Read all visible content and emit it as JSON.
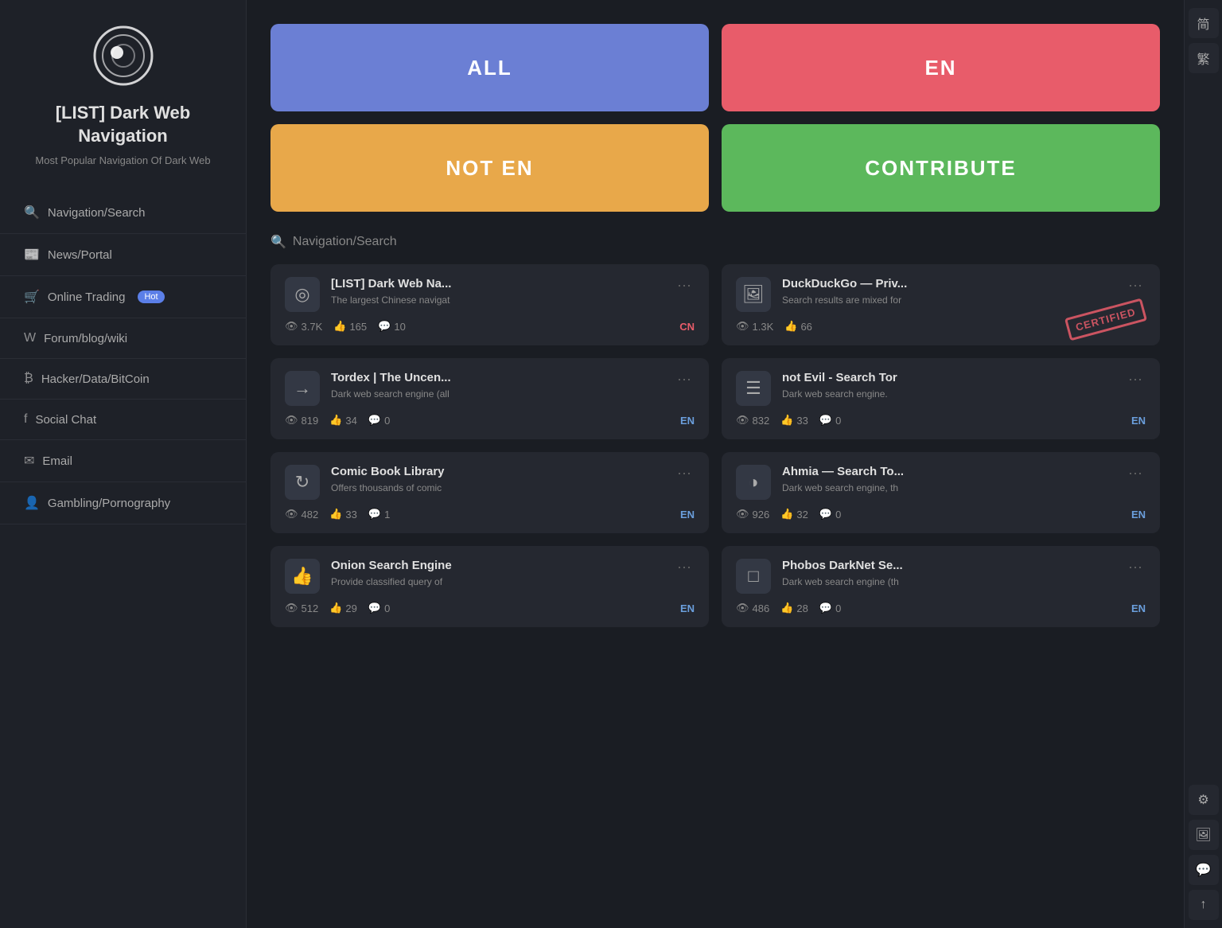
{
  "sidebar": {
    "title": "[LIST] Dark Web Navigation",
    "subtitle": "Most Popular Navigation Of Dark Web",
    "nav_items": [
      {
        "id": "navigation-search",
        "icon": "🔍",
        "label": "Navigation/Search"
      },
      {
        "id": "news-portal",
        "icon": "📰",
        "label": "News/Portal"
      },
      {
        "id": "online-trading",
        "icon": "🛒",
        "label": "Online Trading",
        "badge": "Hot"
      },
      {
        "id": "forum-blog-wiki",
        "icon": "W",
        "label": "Forum/blog/wiki"
      },
      {
        "id": "hacker-data-bitcoin",
        "icon": "₿",
        "label": "Hacker/Data/BitCoin"
      },
      {
        "id": "social-chat",
        "icon": "f",
        "label": "Social Chat"
      },
      {
        "id": "email",
        "icon": "✉",
        "label": "Email"
      },
      {
        "id": "gambling-pornography",
        "icon": "👤",
        "label": "Gambling/Pornography"
      }
    ]
  },
  "top_buttons": [
    {
      "id": "all",
      "label": "ALL",
      "class": "btn-all"
    },
    {
      "id": "en",
      "label": "EN",
      "class": "btn-en"
    },
    {
      "id": "not-en",
      "label": "NOT EN",
      "class": "btn-noten"
    },
    {
      "id": "contribute",
      "label": "CONTRIBUTE",
      "class": "btn-contribute"
    }
  ],
  "section_label": "Navigation/Search",
  "cards": [
    {
      "id": "card-list-dark-web",
      "icon": "◎",
      "title": "[LIST] Dark Web Na...",
      "desc": "The largest Chinese navigat",
      "views": "3.7K",
      "likes": "165",
      "comments": "10",
      "lang": "CN",
      "lang_class": "lang-cn",
      "certified": false
    },
    {
      "id": "card-duckduckgo",
      "icon": "🖼",
      "title": "DuckDuckGo — Priv...",
      "desc": "Search results are mixed for",
      "views": "1.3K",
      "likes": "66",
      "comments": "",
      "lang": "",
      "lang_class": "",
      "certified": true
    },
    {
      "id": "card-tordex",
      "icon": "→",
      "title": "Tordex | The Uncen...",
      "desc": "Dark web search engine (all",
      "views": "819",
      "likes": "34",
      "comments": "0",
      "lang": "EN",
      "lang_class": "lang-en",
      "certified": false
    },
    {
      "id": "card-not-evil",
      "icon": "☰",
      "title": "not Evil - Search Tor",
      "desc": "Dark web search engine.",
      "views": "832",
      "likes": "33",
      "comments": "0",
      "lang": "EN",
      "lang_class": "lang-en",
      "certified": false
    },
    {
      "id": "card-comic-book",
      "icon": "↻",
      "title": "Comic Book Library",
      "desc": "Offers thousands of comic",
      "views": "482",
      "likes": "33",
      "comments": "1",
      "lang": "EN",
      "lang_class": "lang-en",
      "certified": false
    },
    {
      "id": "card-ahmia",
      "icon": "◑",
      "title": "Ahmia — Search To...",
      "desc": "Dark web search engine, th",
      "views": "926",
      "likes": "32",
      "comments": "0",
      "lang": "EN",
      "lang_class": "lang-en",
      "certified": false
    },
    {
      "id": "card-onion-search",
      "icon": "👍",
      "title": "Onion Search Engine",
      "desc": "Provide classified query of",
      "views": "512",
      "likes": "29",
      "comments": "0",
      "lang": "EN",
      "lang_class": "lang-en",
      "certified": false
    },
    {
      "id": "card-phobos",
      "icon": "□",
      "title": "Phobos DarkNet Se...",
      "desc": "Dark web search engine (th",
      "views": "486",
      "likes": "28",
      "comments": "0",
      "lang": "EN",
      "lang_class": "lang-en",
      "certified": false
    }
  ],
  "right_panel_buttons": [
    {
      "id": "simplified-chinese",
      "icon": "简"
    },
    {
      "id": "traditional-chinese",
      "icon": "繁"
    },
    {
      "id": "settings",
      "icon": "⚙"
    },
    {
      "id": "image",
      "icon": "🖼"
    },
    {
      "id": "chat",
      "icon": "💬"
    },
    {
      "id": "upload",
      "icon": "↑"
    }
  ],
  "certified_label": "CERTIFIED"
}
